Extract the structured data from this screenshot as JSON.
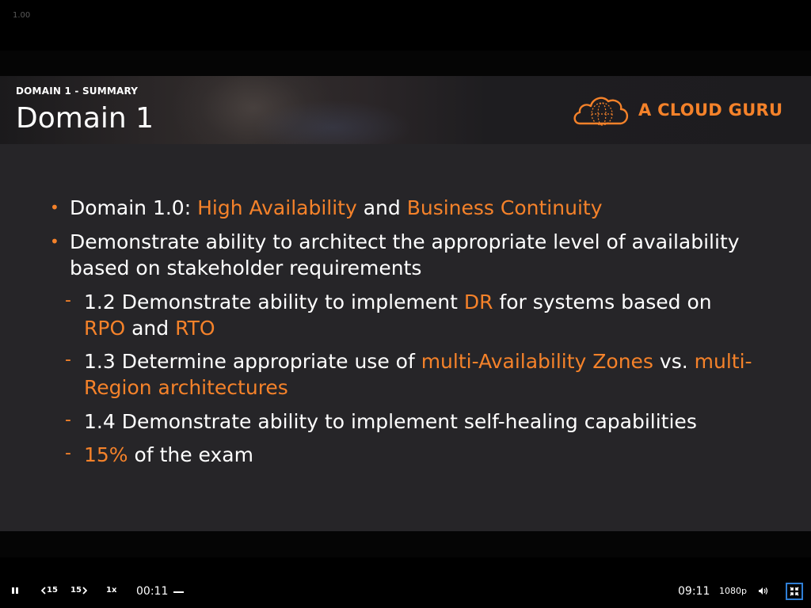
{
  "player": {
    "speed_readout": "1.00"
  },
  "slide": {
    "section_label": "DOMAIN 1 - SUMMARY",
    "title": "Domain 1",
    "logo_text": "A CLOUD GURU",
    "accent_color": "#f5822a",
    "bullets": [
      {
        "level": 1,
        "lines": [
          [
            {
              "t": "Domain 1.0: ",
              "hl": false
            },
            {
              "t": "High Availability",
              "hl": true
            },
            {
              "t": " and ",
              "hl": false
            },
            {
              "t": "Business Continuity",
              "hl": true
            }
          ]
        ]
      },
      {
        "level": 1,
        "lines": [
          [
            {
              "t": "Demonstrate ability to architect the appropriate level of availability",
              "hl": false
            }
          ],
          [
            {
              "t": "based on stakeholder requirements",
              "hl": false
            }
          ]
        ]
      },
      {
        "level": 2,
        "lines": [
          [
            {
              "t": "1.2 Demonstrate ability to implement ",
              "hl": false
            },
            {
              "t": "DR",
              "hl": true
            },
            {
              "t": " for systems based on",
              "hl": false
            }
          ],
          [
            {
              "t": "RPO",
              "hl": true
            },
            {
              "t": " and ",
              "hl": false
            },
            {
              "t": "RTO",
              "hl": true
            }
          ]
        ]
      },
      {
        "level": 2,
        "lines": [
          [
            {
              "t": "1.3 Determine appropriate use of ",
              "hl": false
            },
            {
              "t": "multi-Availability Zones",
              "hl": true
            },
            {
              "t": " vs. ",
              "hl": false
            },
            {
              "t": "multi-",
              "hl": true
            }
          ],
          [
            {
              "t": "Region architectures",
              "hl": true
            }
          ]
        ]
      },
      {
        "level": 2,
        "lines": [
          [
            {
              "t": "1.4 Demonstrate ability to implement self-healing capabilities",
              "hl": false
            }
          ]
        ]
      },
      {
        "level": 2,
        "lines": [
          [
            {
              "t": "15%",
              "hl": true
            },
            {
              "t": " of the exam",
              "hl": false
            }
          ]
        ]
      }
    ]
  },
  "controls": {
    "pause_icon": "pause-icon",
    "rewind_label": "15",
    "forward_label": "15",
    "playback_rate": "1x",
    "current_time": "00:11",
    "duration": "09:11",
    "quality": "1080p",
    "volume_icon": "volume-icon",
    "fullscreen_icon": "exit-fullscreen-icon"
  }
}
